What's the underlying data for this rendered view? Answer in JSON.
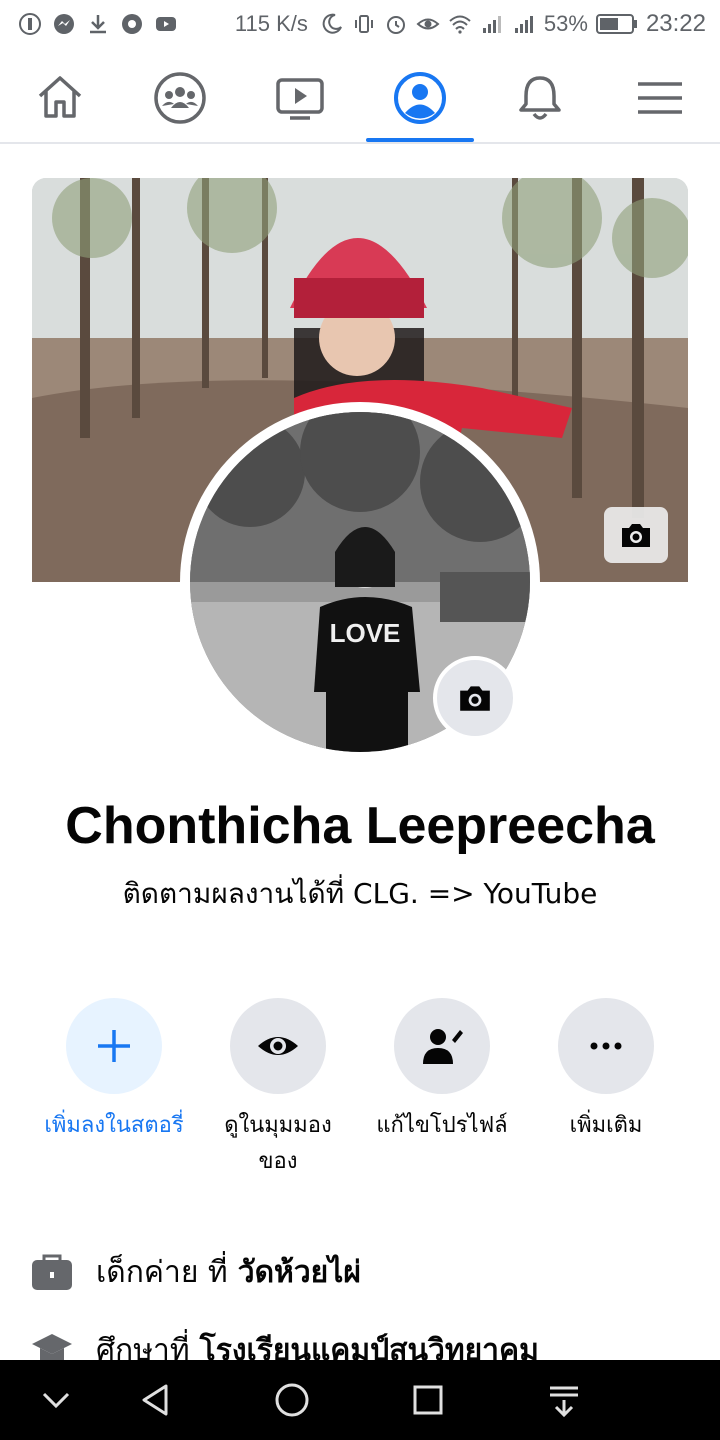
{
  "status_bar": {
    "speed": "115 K/s",
    "battery_percent": "53%",
    "time": "23:22",
    "icons": [
      "privacy-icon",
      "messenger-icon",
      "download-icon",
      "chrome-icon",
      "youtube-icon",
      "moon-icon",
      "vibrate-icon",
      "alarm-icon",
      "eye-icon",
      "wifi-icon",
      "signal-icon",
      "signal-icon",
      "battery-icon"
    ]
  },
  "nav": {
    "tabs": [
      {
        "name": "home-icon",
        "active": false
      },
      {
        "name": "groups-icon",
        "active": false
      },
      {
        "name": "watch-icon",
        "active": false
      },
      {
        "name": "profile-icon",
        "active": true
      },
      {
        "name": "bell-icon",
        "active": false
      },
      {
        "name": "menu-icon",
        "active": false
      }
    ],
    "accent": "#1877f2"
  },
  "profile": {
    "name": "Chonthicha Leepreecha",
    "bio": "ติดตามผลงานได้ที่ CLG. => YouTube"
  },
  "actions": [
    {
      "label": "เพิ่มลงในสตอรี่",
      "icon": "plus-icon"
    },
    {
      "label": "ดูในมุมมองของ",
      "icon": "eye-icon"
    },
    {
      "label": "แก้ไขโปรไฟล์",
      "icon": "edit-profile-icon"
    },
    {
      "label": "เพิ่มเติม",
      "icon": "more-icon"
    }
  ],
  "intro": {
    "work": {
      "prefix": "เด็กค่าย ที่",
      "place": "วัดห้วยไผ่"
    },
    "education": {
      "prefix": "ศึกษาที่",
      "place": "โรงเรียนแคมป์สนวิทยาคม"
    }
  }
}
